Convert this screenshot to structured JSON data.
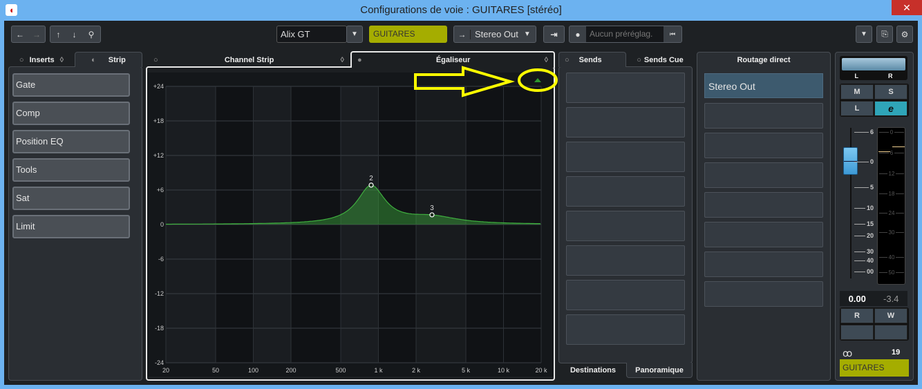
{
  "window": {
    "title": "Configurations de voie : GUITARES [stéréo]",
    "close": "✕"
  },
  "toolbar": {
    "preset_name": "Alix GT",
    "channel_name": "GUITARES",
    "output": "Stereo Out",
    "preset_placeholder": "Aucun préréglag.",
    "channel_color": "#a5ad00"
  },
  "left_tabs": {
    "inserts": "Inserts",
    "strip": "Strip"
  },
  "strip_modules": [
    "Gate",
    "Comp",
    "Position EQ",
    "Tools",
    "Sat",
    "Limit"
  ],
  "center_tabs": {
    "channel_strip": "Channel Strip",
    "equalizer": "Égaliseur"
  },
  "eq": {
    "db_labels": [
      "+24",
      "+18",
      "+12",
      "+6",
      "0",
      "-6",
      "-12",
      "-18",
      "-24"
    ],
    "db_values": [
      24,
      18,
      12,
      6,
      0,
      -6,
      -12,
      -18,
      -24
    ],
    "freq_labels": [
      "20",
      "50",
      "100",
      "200",
      "500",
      "1 k",
      "2 k",
      "5 k",
      "10 k",
      "20 k"
    ],
    "freq_values": [
      20,
      50,
      100,
      200,
      500,
      1000,
      2000,
      5000,
      10000,
      20000
    ],
    "bands": [
      {
        "label": "2",
        "freq": 875,
        "gain": 6.6,
        "q": 2.2
      },
      {
        "label": "3",
        "freq": 2680,
        "gain": 1.2,
        "q": 1.2
      }
    ]
  },
  "sends": {
    "tab_sends": "Sends",
    "tab_cue": "Sends Cue",
    "bottom_destinations": "Destinations",
    "bottom_pan": "Panoramique",
    "slot_count": 8
  },
  "routing": {
    "title": "Routage direct",
    "first": "Stereo Out",
    "slot_count": 7
  },
  "fader": {
    "pan_l": "L",
    "pan_r": "R",
    "mute": "M",
    "solo": "S",
    "listen": "L",
    "edit": "e",
    "fader_scale": [
      "6",
      "0",
      "5",
      "10",
      "15",
      "20",
      "30",
      "40",
      "00"
    ],
    "meter_scale": [
      "0",
      "6",
      "12",
      "18",
      "24",
      "30",
      "40",
      "50"
    ],
    "volume": "0.00",
    "peak": "-3.4",
    "read": "R",
    "write": "W",
    "channel_number": "19",
    "channel_name": "GUITARES"
  }
}
